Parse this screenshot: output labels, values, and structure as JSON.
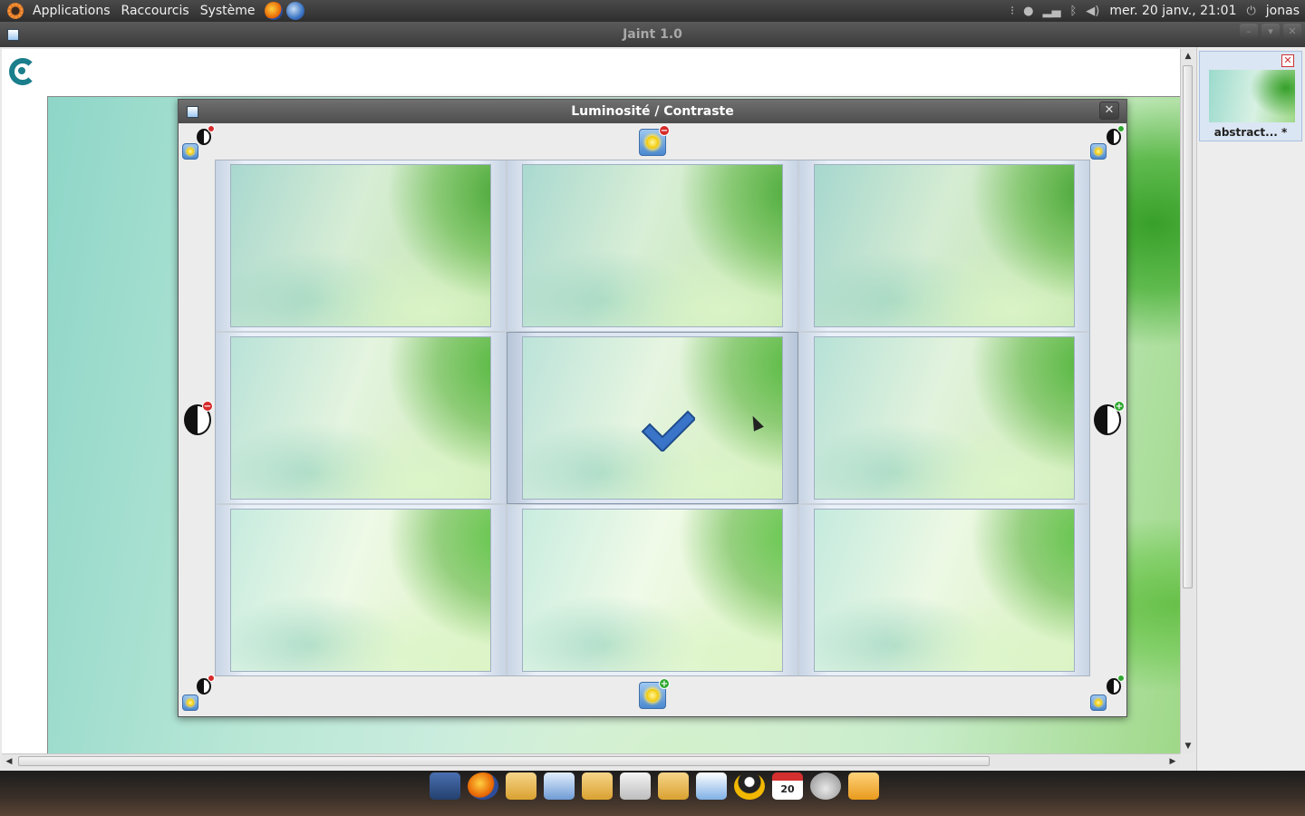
{
  "panel": {
    "menus": [
      "Applications",
      "Raccourcis",
      "Système"
    ],
    "clock": "mer. 20 janv., 21:01",
    "user": "jonas"
  },
  "app": {
    "title": "Jaint 1.0",
    "image_tab_label": "abstract... *"
  },
  "dialog": {
    "title": "Luminosité / Contraste",
    "close_glyph": "✕"
  },
  "previews": [
    {
      "a": "#a9d8cf",
      "b": "#d7edd5",
      "c": "#bfe3a8",
      "leaf": "#4aa838"
    },
    {
      "a": "#aad9d0",
      "b": "#d8eed6",
      "c": "#c0e4aa",
      "leaf": "#4cab3a"
    },
    {
      "a": "#a6d7ce",
      "b": "#d5ecd3",
      "c": "#bde2a6",
      "leaf": "#48a636"
    },
    {
      "a": "#b9e2d8",
      "b": "#e4f4df",
      "c": "#cdeab6",
      "leaf": "#56b840"
    },
    {
      "a": "#bce3d9",
      "b": "#e6f5e1",
      "c": "#cfebb8",
      "leaf": "#58ba42"
    },
    {
      "a": "#b7e1d7",
      "b": "#e2f3dd",
      "c": "#cbe9b4",
      "leaf": "#54b63e"
    },
    {
      "a": "#c6ebdf",
      "b": "#eef9e6",
      "c": "#dcf2c4",
      "leaf": "#64c64c"
    },
    {
      "a": "#c8ecdf",
      "b": "#f0fae8",
      "c": "#def3c6",
      "leaf": "#66c84e"
    },
    {
      "a": "#c4eade",
      "b": "#ecf8e4",
      "c": "#daf1c2",
      "leaf": "#62c44a"
    }
  ],
  "selected_preview": 4,
  "icons": {
    "brightness": "sun-icon",
    "contrast": "contrast-icon",
    "confirm": "checkmark-icon"
  },
  "dock_icons": [
    "dock-files",
    "firefox",
    "folder",
    "cube-app",
    "folder",
    "image-viewer",
    "folder",
    "jaint",
    "tux",
    "calendar",
    "cloud-app",
    "trash"
  ],
  "calendar_day": "20"
}
